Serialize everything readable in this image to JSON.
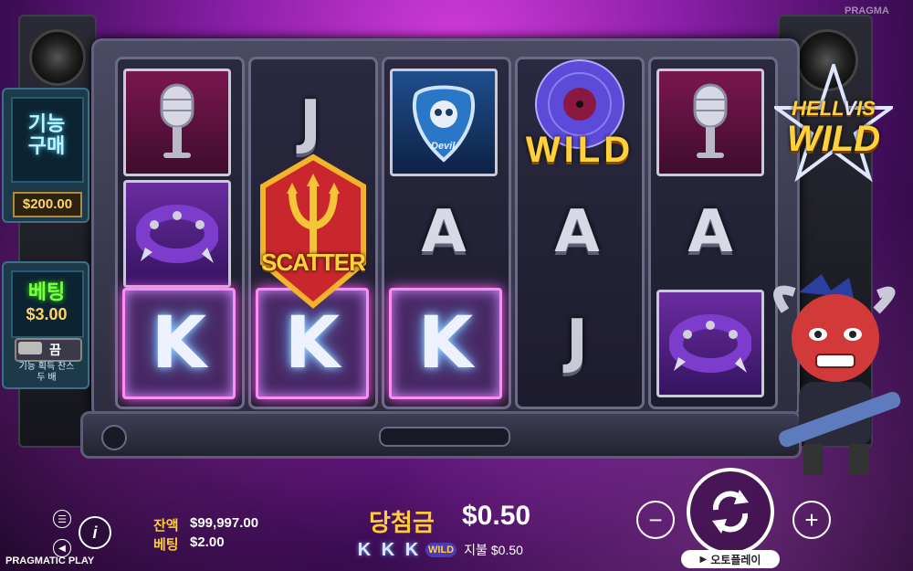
{
  "provider": "PRAGMATIC PLAY",
  "watermark": "PRAGMA",
  "game_logo": {
    "line1": "HELL",
    "line2": "IS",
    "line3": "WILD",
    "mark": "V"
  },
  "left_panel": {
    "buy_feature_label": "기능\n구매",
    "buy_feature_price": "$200.00",
    "bet_label": "베팅",
    "bet_amount": "$3.00",
    "toggle_state": "끔",
    "double_chance_label": "기능 획득 찬스\n두 배"
  },
  "reels": [
    [
      "mic",
      "bracelet",
      "K"
    ],
    [
      "J",
      "scatter",
      "K"
    ],
    [
      "pick",
      "A",
      "K"
    ],
    [
      "wild",
      "A",
      "J"
    ],
    [
      "mic",
      "A",
      "bracelet"
    ]
  ],
  "symbols": {
    "scatter_label": "SCATTER",
    "wild_label": "WILD",
    "pick_label": "Devil"
  },
  "balance": {
    "label": "잔액",
    "value": "$99,997.00"
  },
  "bet": {
    "label": "베팅",
    "value": "$2.00"
  },
  "win": {
    "label": "당첨금",
    "value": "$0.50"
  },
  "payline_info": {
    "symbols": [
      "K",
      "K",
      "K",
      "WILD"
    ],
    "pays_label": "지불",
    "pays_value": "$0.50"
  },
  "autoplay_label": "오토플레이",
  "controls": {
    "minus": "−",
    "plus": "+",
    "info": "i"
  }
}
